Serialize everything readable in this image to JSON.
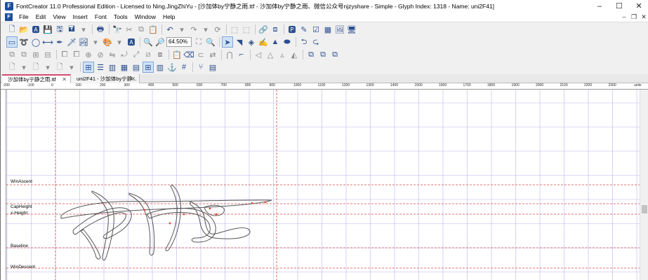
{
  "window": {
    "title": "FontCreator 11.0 Professional Edition - Licensed to Ning.JingZhiYu - [沙加体by宁静之雨.ttf - 沙加体by宁静之雨、微信公众号njzyshare - Simple - Glyph Index: 1318 - Name: uni2F41]",
    "app_icon": "F",
    "minimize": "–",
    "maximize": "☐",
    "close": "✕"
  },
  "menu": {
    "items": [
      "File",
      "Edit",
      "View",
      "Insert",
      "Font",
      "Tools",
      "Window",
      "Help"
    ],
    "mdi_minimize": "–",
    "mdi_restore": "❐",
    "mdi_close": "✕"
  },
  "toolbar": {
    "zoom_value": "64.50%"
  },
  "tabs": [
    {
      "label": "沙加体by宁静之雨.ttf",
      "close": "✕"
    },
    {
      "label": "uni2F41 - 沙加体by宁静...",
      "close": "✕"
    }
  ],
  "ruler": {
    "top_labels": [
      "-200",
      "-100",
      "0",
      "100",
      "200",
      "300",
      "400",
      "500",
      "600",
      "700",
      "800",
      "900",
      "1000",
      "1100",
      "1200",
      "1300",
      "1400",
      "1500",
      "1600",
      "1700",
      "1800",
      "1900",
      "2000",
      "2100",
      "2200",
      "2300"
    ],
    "units": "units"
  },
  "metrics": {
    "win_ascent": "WinAscent",
    "cap_height": "CapHeight",
    "x_height": "x-Height",
    "baseline": "Baseline",
    "win_descent": "WinDescent"
  },
  "colors": {
    "grid": "#b9b6ee",
    "metric_line": "#d84545",
    "outline": "#555555",
    "tab_accent": "#d24b6e"
  }
}
